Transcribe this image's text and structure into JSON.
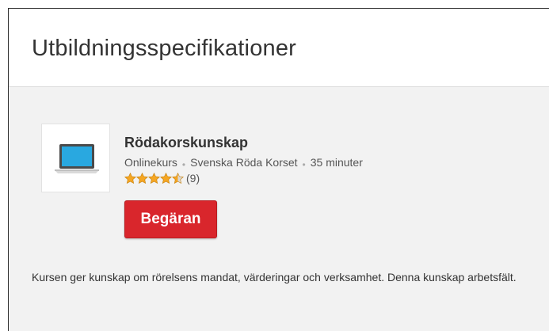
{
  "page": {
    "title": "Utbildningsspecifikationer"
  },
  "course": {
    "icon": "laptop-icon",
    "name": "Rödakorskunskap",
    "type": "Onlinekurs",
    "provider": "Svenska Röda Korset",
    "duration": "35 minuter",
    "rating": 4.5,
    "rating_max": 5,
    "rating_count": "(9)",
    "request_button": "Begäran",
    "description": "Kursen ger kunskap om rörelsens mandat, värderingar och verksamhet. Denna kunskap arbetsfält."
  },
  "colors": {
    "accent": "#d9262c",
    "star": "#f5a623",
    "laptop_screen": "#29a8e0"
  }
}
